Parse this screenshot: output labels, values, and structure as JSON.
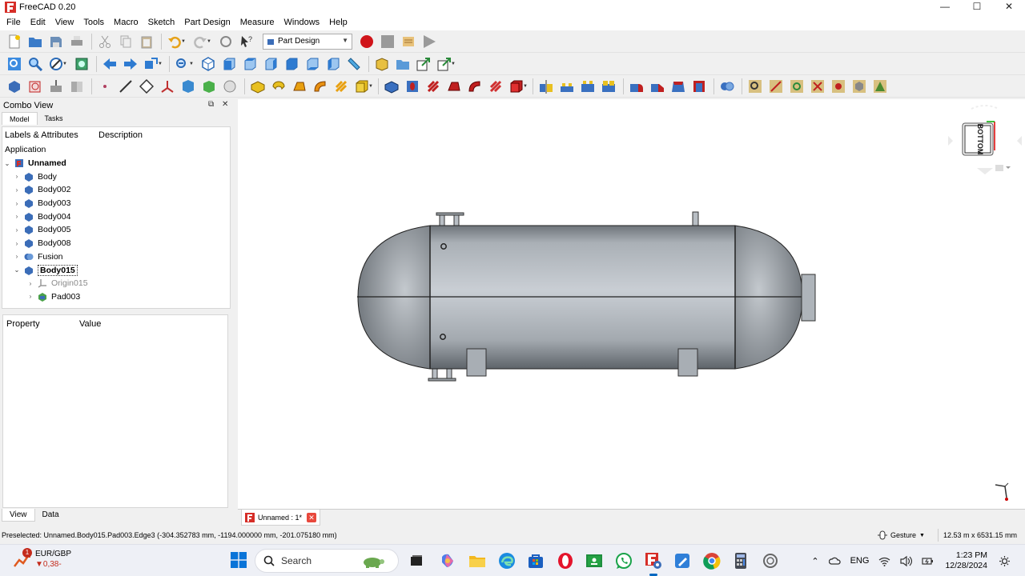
{
  "window": {
    "title": "FreeCAD 0.20",
    "controls": {
      "minimize": "—",
      "maximize": "☐",
      "close": "✕"
    }
  },
  "menu": [
    "File",
    "Edit",
    "View",
    "Tools",
    "Macro",
    "Sketch",
    "Part Design",
    "Measure",
    "Windows",
    "Help"
  ],
  "workbench_selector": {
    "value": "Part Design"
  },
  "combo_view": {
    "title": "Combo View",
    "tabs": [
      "Model",
      "Tasks"
    ],
    "tree_headers": [
      "Labels & Attributes",
      "Description"
    ],
    "section": "Application",
    "document": "Unnamed",
    "items": [
      {
        "label": "Body"
      },
      {
        "label": "Body002"
      },
      {
        "label": "Body003"
      },
      {
        "label": "Body004"
      },
      {
        "label": "Body005"
      },
      {
        "label": "Body008"
      },
      {
        "label": "Fusion"
      },
      {
        "label": "Body015"
      }
    ],
    "children": [
      {
        "label": "Origin015"
      },
      {
        "label": "Pad003"
      }
    ],
    "property_headers": [
      "Property",
      "Value"
    ],
    "bottom_tabs": [
      "View",
      "Data"
    ]
  },
  "navcube": {
    "face": "BOTTOM"
  },
  "document_tab": {
    "label": "Unnamed : 1*"
  },
  "status": {
    "message": "Preselected: Unnamed.Body015.Pad003.Edge3 (-304.352783 mm, -1194.000000 mm, -201.075180 mm)",
    "nav_style": "Gesture",
    "dimensions": "12.53 m x 6531.15 mm"
  },
  "taskbar": {
    "ticker_name": "EUR/GBP",
    "ticker_change": "▼0,38-",
    "notification_count": "1",
    "search_placeholder": "Search",
    "language": "ENG",
    "time": "1:23 PM",
    "date": "12/28/2024"
  },
  "colors": {
    "accent": "#0067c0",
    "record": "#d0141a",
    "vessel_light": "#c8cdd3",
    "vessel_dark": "#6e747a"
  }
}
